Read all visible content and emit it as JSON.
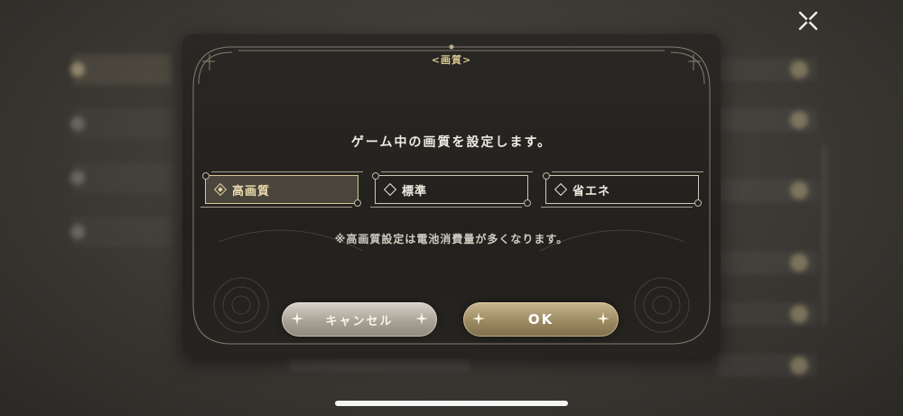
{
  "dialog": {
    "title": "<画質>",
    "message": "ゲーム中の画質を設定します。",
    "note": "※高画質設定は電池消費量が多くなります。",
    "options": [
      {
        "label": "高画質",
        "selected": true
      },
      {
        "label": "標準",
        "selected": false
      },
      {
        "label": "省エネ",
        "selected": false
      }
    ],
    "cancel_label": "キャンセル",
    "ok_label": "OK"
  },
  "icons": {
    "close": "close-icon",
    "radio": "diamond-radio-icon",
    "sparkle": "sparkle-icon"
  },
  "colors": {
    "accent_gold": "#d9c693",
    "dialog_bg": "#23211e",
    "ok_button": "#9c8a62",
    "cancel_button": "#a9a397"
  }
}
